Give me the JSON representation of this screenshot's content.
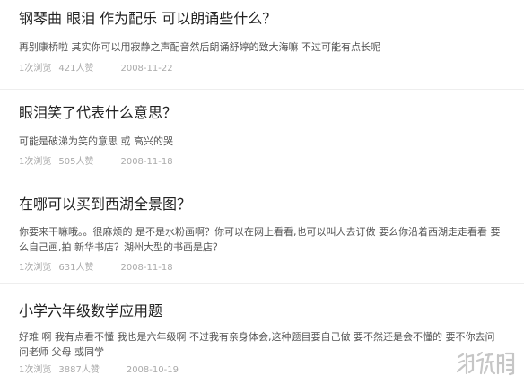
{
  "items": [
    {
      "title": "钢琴曲 眼泪 作为配乐 可以朗诵些什么？",
      "answer": "再别康桥啦 其实你可以用寂静之声配音然后朗诵舒婷的致大海嘛 不过可能有点长呢",
      "views": "1次浏览",
      "likes": "421人赞",
      "date": "2008-11-22"
    },
    {
      "title": "眼泪笑了代表什么意思？",
      "answer": "可能是破涕为笑的意思 或 高兴的哭",
      "views": "1次浏览",
      "likes": "505人赞",
      "date": "2008-11-18"
    },
    {
      "title": "在哪可以买到西湖全景图？",
      "answer": "你要来干嘛哦。。很麻烦的 是不是水粉画啊？你可以在网上看看,也可以叫人去订做 要么你沿着西湖走走看看 要么自己画,拍 新华书店？湖州大型的书画是店？",
      "views": "1次浏览",
      "likes": "631人赞",
      "date": "2008-11-18"
    },
    {
      "title": "小学六年级数学应用题",
      "answer": "好难 啊 我有点看不懂 我也是六年级啊 不过我有亲身体会,这种题目要自己做 要不然还是会不懂的 要不你去问问老师 父母 或同学",
      "views": "1次浏览",
      "likes": "3887人赞",
      "date": "2008-10-19"
    }
  ],
  "watermark": {
    "text": "游侠网",
    "color": "#bbbbbb"
  }
}
